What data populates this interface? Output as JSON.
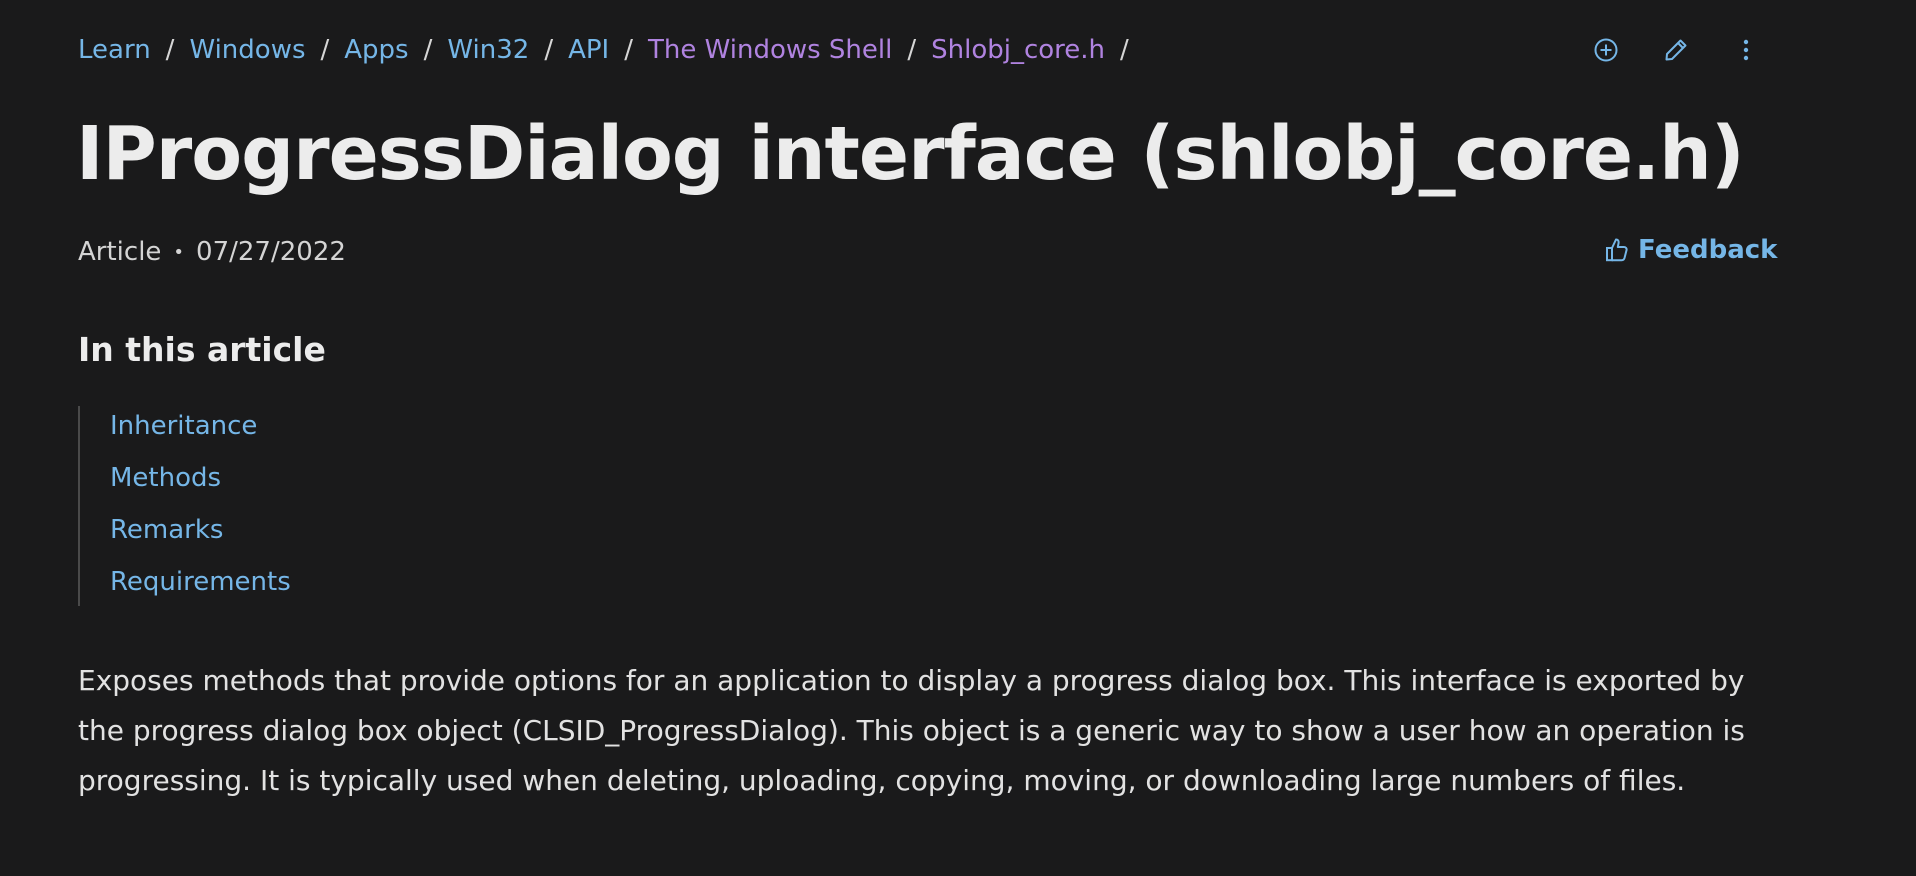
{
  "breadcrumb": {
    "items": [
      {
        "label": "Learn",
        "visited": false
      },
      {
        "label": "Windows",
        "visited": false
      },
      {
        "label": "Apps",
        "visited": false
      },
      {
        "label": "Win32",
        "visited": false
      },
      {
        "label": "API",
        "visited": false
      },
      {
        "label": "The Windows Shell",
        "visited": true
      },
      {
        "label": "Shlobj_core.h",
        "visited": true
      }
    ],
    "separator": "/"
  },
  "actions": {
    "add_icon": "circle-plus-icon",
    "edit_icon": "pencil-icon",
    "more_icon": "more-vertical-icon"
  },
  "title": "IProgressDialog interface (shlobj_core.h)",
  "meta": {
    "type": "Article",
    "dot": "•",
    "date": "07/27/2022"
  },
  "feedback": {
    "label": "Feedback",
    "icon": "thumbs-up-icon"
  },
  "toc": {
    "heading": "In this article",
    "items": [
      "Inheritance",
      "Methods",
      "Remarks",
      "Requirements"
    ]
  },
  "body": {
    "paragraph": "Exposes methods that provide options for an application to display a progress dialog box. This interface is exported by the progress dialog box object (CLSID_ProgressDialog). This object is a generic way to show a user how an operation is progressing. It is typically used when deleting, uploading, copying, moving, or downloading large numbers of files."
  },
  "colors": {
    "background": "#1a1a1b",
    "link": "#75b6e7",
    "visited_link": "#b083e0",
    "text": "#e6e6e6"
  }
}
